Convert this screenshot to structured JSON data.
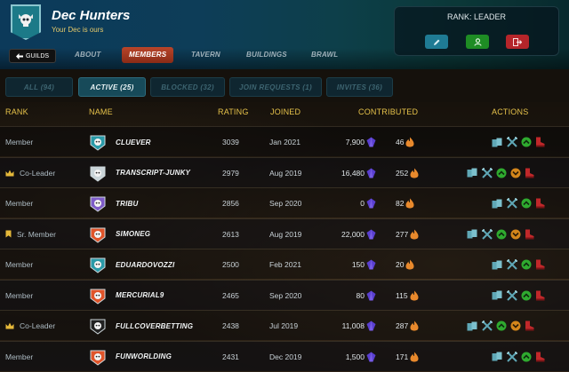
{
  "guild": {
    "name": "Dec Hunters",
    "motto": "Your Dec is ours",
    "brand_color": "#1c7a88"
  },
  "back_button": {
    "label": "GUILDS",
    "icon": "arrow-left-icon"
  },
  "nav_tabs": [
    {
      "label": "ABOUT",
      "active": false
    },
    {
      "label": "MEMBERS",
      "active": true
    },
    {
      "label": "TAVERN",
      "active": false
    },
    {
      "label": "BUILDINGS",
      "active": false
    },
    {
      "label": "BRAWL",
      "active": false
    }
  ],
  "rank_panel": {
    "label": "RANK: LEADER",
    "buttons": [
      {
        "icon": "pencil-icon",
        "color": "#1f7b94"
      },
      {
        "icon": "user-icon",
        "color": "#1e8c24"
      },
      {
        "icon": "leave-icon",
        "color": "#b5252a"
      }
    ]
  },
  "filter_tabs": [
    {
      "label": "ALL (94)",
      "active": false
    },
    {
      "label": "ACTIVE (25)",
      "active": true
    },
    {
      "label": "BLOCKED (32)",
      "active": false
    },
    {
      "label": "JOIN REQUESTS (1)",
      "active": false
    },
    {
      "label": "INVITES (36)",
      "active": false
    }
  ],
  "table": {
    "headers": {
      "rank": "RANK",
      "name": "NAME",
      "rating": "RATING",
      "joined": "JOINED",
      "contributed": "CONTRIBUTED",
      "actions": "ACTIONS"
    },
    "rows": [
      {
        "rank": "Member",
        "rank_icon": "",
        "name": "CLUEVER",
        "rating": "3039",
        "joined": "Jan 2021",
        "dec": "7,900",
        "merits": "46",
        "avatar_color": "#2a9aa8",
        "can_promote": false,
        "can_demote": false
      },
      {
        "rank": "Co-Leader",
        "rank_icon": "crown-icon",
        "name": "TRANSCRIPT-JUNKY",
        "rating": "2979",
        "joined": "Aug 2019",
        "dec": "16,480",
        "merits": "252",
        "avatar_color": "#c9d4d8",
        "can_promote": true,
        "can_demote": true
      },
      {
        "rank": "Member",
        "rank_icon": "",
        "name": "TRIBU",
        "rating": "2856",
        "joined": "Sep 2020",
        "dec": "0",
        "merits": "82",
        "avatar_color": "#7e5cc8",
        "can_promote": false,
        "can_demote": false
      },
      {
        "rank": "Sr. Member",
        "rank_icon": "bookmark-icon",
        "name": "SIMONEG",
        "rating": "2613",
        "joined": "Aug 2019",
        "dec": "22,000",
        "merits": "277",
        "avatar_color": "#e0542a",
        "can_promote": true,
        "can_demote": true
      },
      {
        "rank": "Member",
        "rank_icon": "",
        "name": "EDUARDOVOZZI",
        "rating": "2500",
        "joined": "Feb 2021",
        "dec": "150",
        "merits": "20",
        "avatar_color": "#2a9aa8",
        "can_promote": false,
        "can_demote": false
      },
      {
        "rank": "Member",
        "rank_icon": "",
        "name": "MERCURIAL9",
        "rating": "2465",
        "joined": "Sep 2020",
        "dec": "80",
        "merits": "115",
        "avatar_color": "#e0542a",
        "can_promote": false,
        "can_demote": false
      },
      {
        "rank": "Co-Leader",
        "rank_icon": "crown-icon",
        "name": "FULLCOVERBETTING",
        "rating": "2438",
        "joined": "Jul 2019",
        "dec": "11,008",
        "merits": "287",
        "avatar_color": "#222222",
        "can_promote": true,
        "can_demote": true
      },
      {
        "rank": "Member",
        "rank_icon": "",
        "name": "FUNWORLDING",
        "rating": "2431",
        "joined": "Dec 2019",
        "dec": "1,500",
        "merits": "171",
        "avatar_color": "#e0542a",
        "can_promote": false,
        "can_demote": false
      }
    ]
  },
  "colors": {
    "header_gold": "#e6c24a",
    "dec_purple": "#5a3fd0",
    "merit_orange": "#e8892c",
    "promote_green": "#2faa2f",
    "demote_orange": "#d4861b",
    "kick_red": "#c0282a",
    "action_teal": "#5fa7b6"
  }
}
